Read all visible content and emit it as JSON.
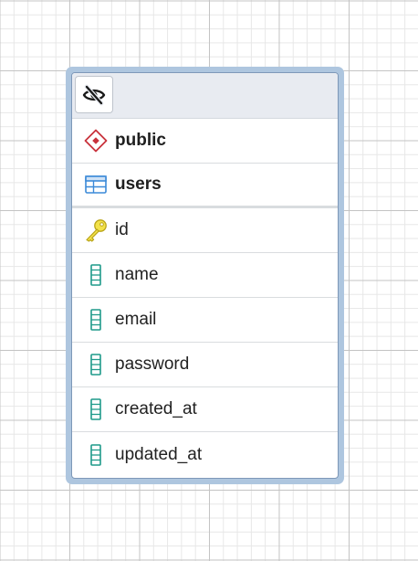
{
  "table_node": {
    "toolbar": {
      "visibility_toggle_icon": "eye-off-icon"
    },
    "schema": {
      "icon": "schema-diamond-icon",
      "label": "public"
    },
    "table": {
      "icon": "table-icon",
      "label": "users"
    },
    "columns": [
      {
        "name": "id",
        "icon": "primary-key-icon"
      },
      {
        "name": "name",
        "icon": "column-icon"
      },
      {
        "name": "email",
        "icon": "column-icon"
      },
      {
        "name": "password",
        "icon": "column-icon"
      },
      {
        "name": "created_at",
        "icon": "column-icon"
      },
      {
        "name": "updated_at",
        "icon": "column-icon"
      }
    ],
    "colors": {
      "schema_icon": "#c8323c",
      "table_icon": "#3c8ad8",
      "key_icon": "#e8d41c",
      "column_icon": "#1f9a8a",
      "node_border": "#aec6df"
    }
  }
}
